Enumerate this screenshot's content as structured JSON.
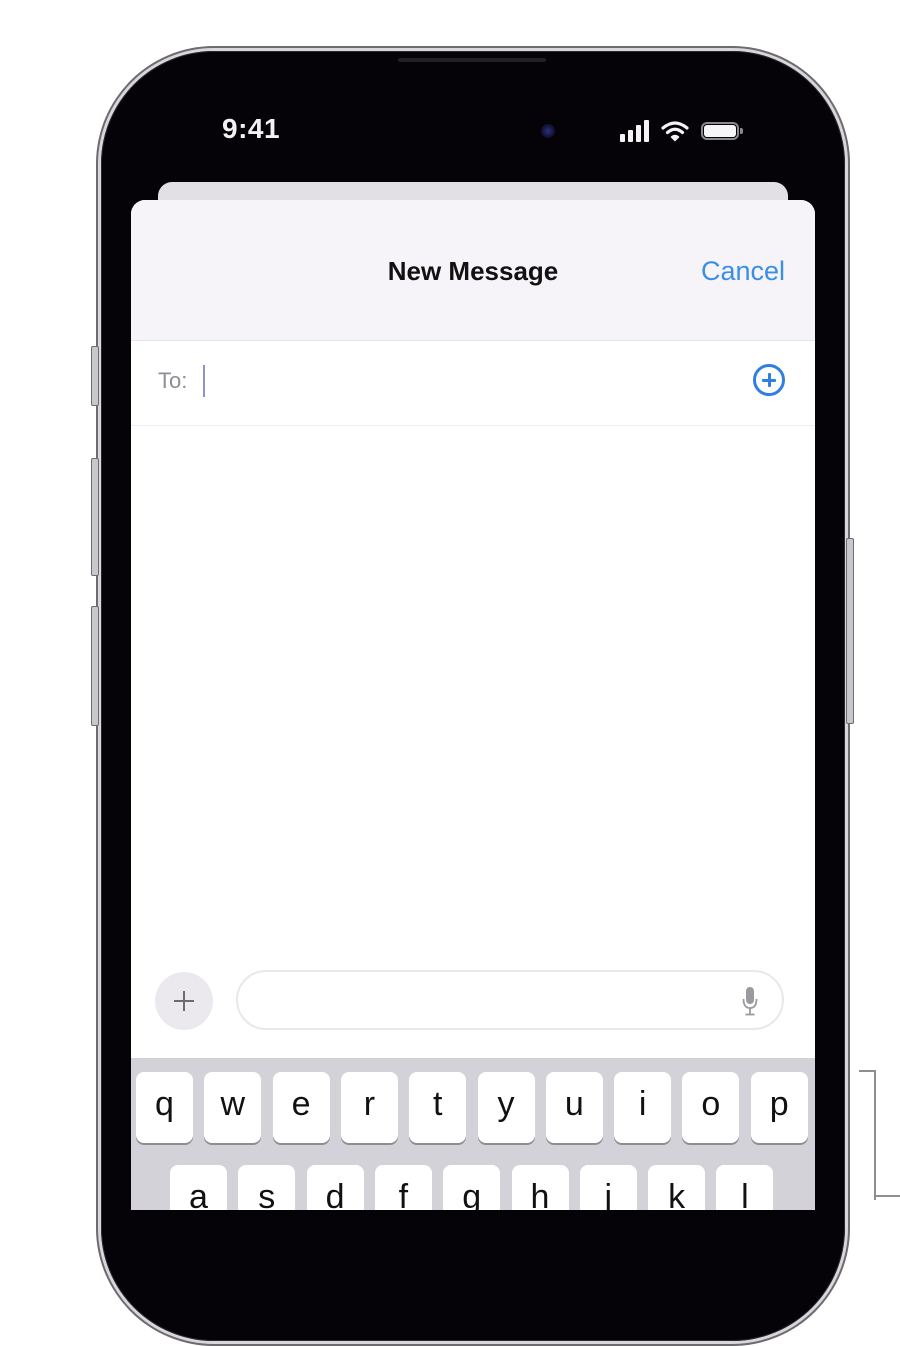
{
  "status_bar": {
    "time": "9:41",
    "icons": [
      "cellular-signal-icon",
      "wifi-icon",
      "battery-icon"
    ]
  },
  "nav": {
    "title": "New Message",
    "cancel_label": "Cancel"
  },
  "to_field": {
    "label": "To:",
    "value": "",
    "add_contact_icon": "plus-circle-icon"
  },
  "compose": {
    "attach_icon": "plus-icon",
    "message_value": "",
    "mic_icon": "microphone-icon"
  },
  "keyboard": {
    "row1": [
      "q",
      "w",
      "e",
      "r",
      "t",
      "y",
      "u",
      "i",
      "o",
      "p"
    ],
    "row2": [
      "a",
      "s",
      "d",
      "f",
      "g",
      "h",
      "j",
      "k",
      "l"
    ]
  },
  "colors": {
    "accent": "#3a8ee6",
    "nav_background": "#f6f4f8",
    "keyboard_background": "#d2d2d8"
  }
}
